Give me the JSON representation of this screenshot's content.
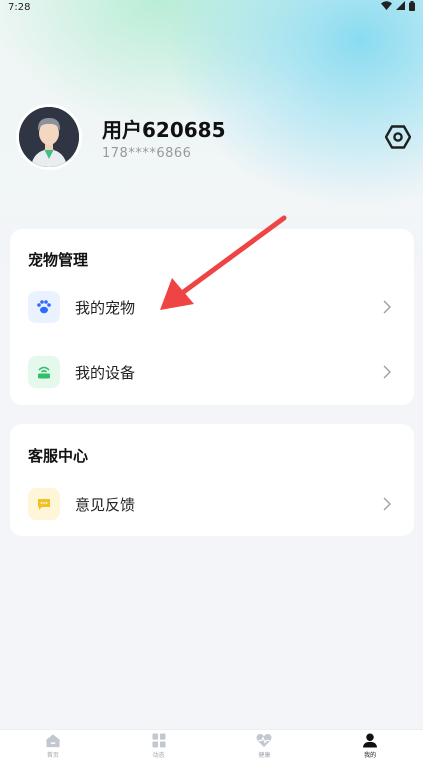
{
  "status_bar": {
    "time": "7:28"
  },
  "profile": {
    "username": "用户620685",
    "phone": "178****6866"
  },
  "pet_card": {
    "title": "宠物管理",
    "items": [
      {
        "label": "我的宠物",
        "icon": "paw-icon",
        "icon_bg": "#eaf2ff",
        "icon_color": "#2f6bff"
      },
      {
        "label": "我的设备",
        "icon": "device-icon",
        "icon_bg": "#e5f8ec",
        "icon_color": "#2fbf6a"
      }
    ]
  },
  "service_card": {
    "title": "客服中心",
    "items": [
      {
        "label": "意见反馈",
        "icon": "feedback-icon",
        "icon_bg": "#fff6d9",
        "icon_color": "#f2c122"
      }
    ]
  },
  "tabbar": {
    "tabs": [
      {
        "label": "首页",
        "icon": "home-icon"
      },
      {
        "label": "动态",
        "icon": "grid-icon"
      },
      {
        "label": "健康",
        "icon": "heart-pulse-icon"
      },
      {
        "label": "我的",
        "icon": "profile-icon",
        "active": true
      }
    ]
  },
  "colors": {
    "accent": "#2f6bff",
    "arrow": "#ef4444",
    "card": "#ffffff",
    "page_bg": "#f4f5f9"
  }
}
